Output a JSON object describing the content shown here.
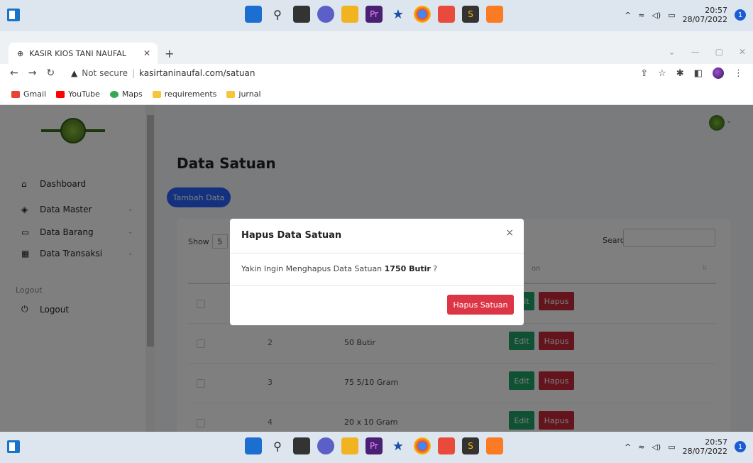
{
  "os": {
    "time": "20:57",
    "date": "28/07/2022",
    "notification_count": "1"
  },
  "browser": {
    "tab_title": "KASIR KIOS TANI NAUFAL",
    "url_security": "Not secure",
    "url": "kasirtaninaufal.com/satuan",
    "bookmarks": [
      "Gmail",
      "YouTube",
      "Maps",
      "requirements",
      "jurnal"
    ]
  },
  "sidebar": {
    "items": [
      {
        "label": "Dashboard"
      },
      {
        "label": "Data Master"
      },
      {
        "label": "Data Barang"
      },
      {
        "label": "Data Transaksi"
      }
    ],
    "logout_heading": "Logout",
    "logout_label": "Logout"
  },
  "main": {
    "title": "Data Satuan",
    "add_button": "Tambah Data",
    "show_label": "Show",
    "show_value": "5",
    "search_label": "Search:",
    "col_partial": "on",
    "rows": [
      {
        "no": "2",
        "name": "50 Butir"
      },
      {
        "no": "3",
        "name": "75 5/10 Gram"
      },
      {
        "no": "4",
        "name": "20 x 10 Gram"
      }
    ],
    "edit_label": "Edit",
    "edit_partial": "it",
    "delete_label": "Hapus"
  },
  "modal": {
    "title": "Hapus Data Satuan",
    "body_prefix": "Yakin Ingin Menghapus Data Satuan",
    "body_item": "1750 Butir",
    "body_suffix": "?",
    "confirm_button": "Hapus Satuan",
    "close_symbol": "×"
  },
  "colors": {
    "primary": "#2962ff",
    "danger": "#dc3545",
    "success": "#21a366"
  }
}
